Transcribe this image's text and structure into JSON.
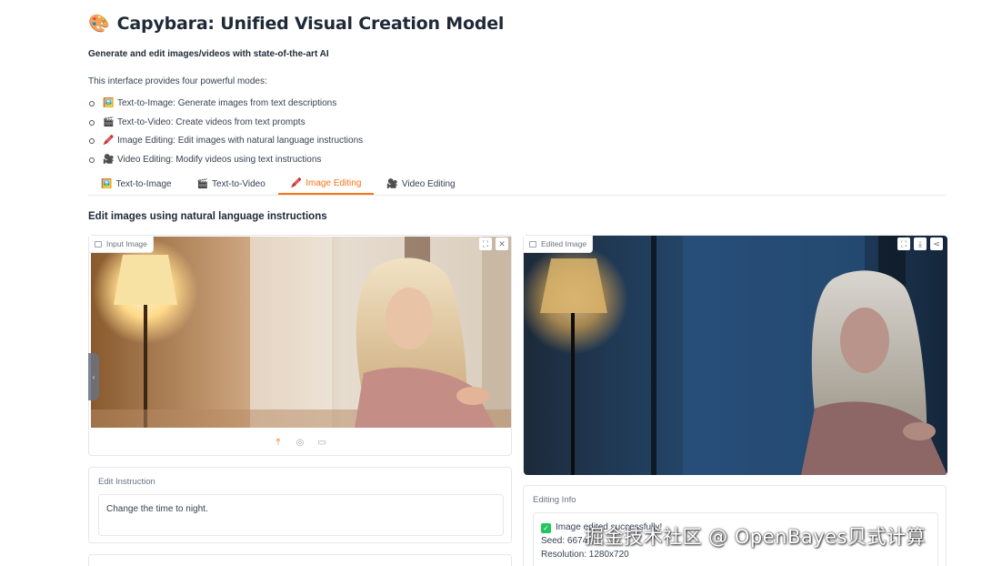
{
  "header": {
    "icon": "palette-icon",
    "icon_glyph": "🎨",
    "title": "Capybara: Unified Visual Creation Model",
    "subtitle": "Generate and edit images/videos with state-of-the-art AI",
    "intro": "This interface provides four powerful modes:"
  },
  "modes": [
    {
      "emoji": "🖼️",
      "text": "Text-to-Image: Generate images from text descriptions"
    },
    {
      "emoji": "🎬",
      "text": "Text-to-Video: Create videos from text prompts"
    },
    {
      "emoji": "🖍️",
      "text": "Image Editing: Edit images with natural language instructions"
    },
    {
      "emoji": "🎥",
      "text": "Video Editing: Modify videos using text instructions"
    }
  ],
  "tabs": [
    {
      "emoji": "🖼️",
      "label": "Text-to-Image",
      "active": false
    },
    {
      "emoji": "🎬",
      "label": "Text-to-Video",
      "active": false
    },
    {
      "emoji": "🖍️",
      "label": "Image Editing",
      "active": true
    },
    {
      "emoji": "🎥",
      "label": "Video Editing",
      "active": false
    }
  ],
  "editing": {
    "section_title": "Edit images using natural language instructions",
    "input_image_label": "Input Image",
    "edited_image_label": "Edited Image",
    "instruction_label": "Edit Instruction",
    "instruction_value": "Change the time to night.",
    "info_label": "Editing Info",
    "info_status": "Image edited successfully!",
    "info_seed": "Seed: 6674",
    "info_resolution": "Resolution: 1280x720"
  },
  "colors": {
    "accent": "#f97316",
    "success": "#22c55e"
  },
  "watermark": "掘金技术社区 @ OpenBayes贝式计算"
}
